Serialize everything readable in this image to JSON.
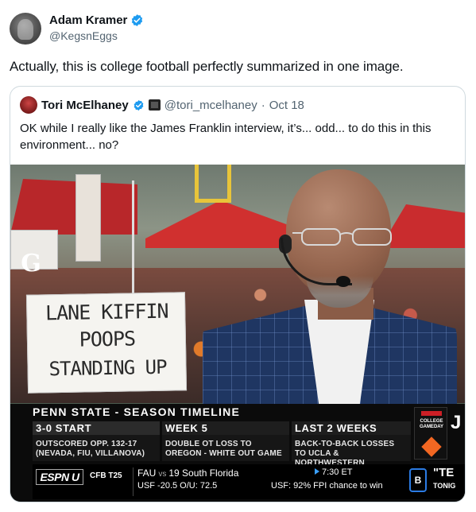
{
  "tweet": {
    "author_name": "Adam Kramer",
    "author_handle": "@KegsnEggs",
    "text": "Actually, this is college football perfectly summarized in one image."
  },
  "quote": {
    "author_name": "Tori McElhaney",
    "author_handle": "@tori_mcelhaney",
    "separator": "·",
    "date": "Oct 18",
    "text": "OK while I really like the James Franklin interview, it’s... odd... to do this in this environment... no?"
  },
  "photo": {
    "fan_sign": [
      "LANE KIFFIN",
      "POOPS",
      "STANDING UP"
    ],
    "background_sign_letter": "G",
    "lower_third": {
      "title": "PENN STATE - SEASON TIMELINE",
      "panels": [
        {
          "head": "3-0 START",
          "body": "OUTSCORED OPP. 132-17 (NEVADA, FIU, VILLANOVA)"
        },
        {
          "head": "WEEK 5",
          "body": "DOUBLE OT LOSS TO OREGON - WHITE OUT GAME"
        },
        {
          "head": "LAST 2 WEEKS",
          "body": "BACK-TO-BACK LOSSES TO UCLA & NORTHWESTERN"
        }
      ],
      "gameday": {
        "brand": "ESPN",
        "label": "COLLEGE GAMEDAY",
        "cut_letter": "J"
      },
      "ticker": {
        "network": "ESPN U",
        "section": "CFB T25",
        "team1": "FAU",
        "vs": "vs",
        "team2": "19 South Florida",
        "time": "7:30 ET",
        "line2": "USF -20.5   O/U: 72.5",
        "fpi": "USF: 92% FPI chance to win",
        "conf_logo": "B",
        "promo_title": "\"TE",
        "promo_sub": "TONIG"
      }
    }
  },
  "colors": {
    "verified_blue": "#1d9bf0",
    "text_primary": "#0f1419",
    "text_secondary": "#536471",
    "border": "#cfd9de",
    "tent_red": "#c4282b",
    "jacket_navy": "#1f3662"
  }
}
